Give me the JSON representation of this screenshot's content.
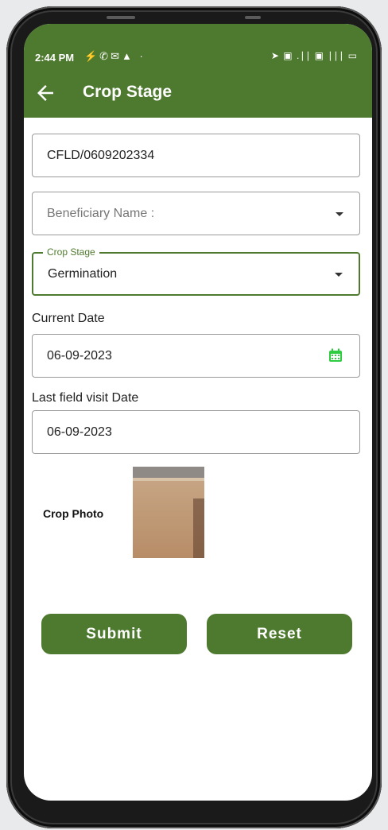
{
  "status_bar": {
    "time": "2:44 PM",
    "left_icons": "⚡✆✉▲ ·",
    "right_icons": "➤ ▣ .∣∣ ▣ ∣∣∣ ▭"
  },
  "app_bar": {
    "title": "Crop Stage",
    "back_icon": "arrow-left-icon"
  },
  "form": {
    "id_field": {
      "value": "CFLD/0609202334"
    },
    "beneficiary": {
      "placeholder": "Beneficiary Name :"
    },
    "crop_stage": {
      "label": "Crop Stage",
      "value": "Germination"
    },
    "current_date": {
      "label": "Current Date",
      "value": "06-09-2023",
      "icon": "calendar-icon"
    },
    "last_visit": {
      "label": "Last field visit Date",
      "value": "06-09-2023"
    },
    "photo": {
      "label": "Crop Photo"
    }
  },
  "actions": {
    "submit": "Submit",
    "reset": "Reset"
  },
  "colors": {
    "primary": "#4e7a2f",
    "calendar": "#2ecc40"
  }
}
